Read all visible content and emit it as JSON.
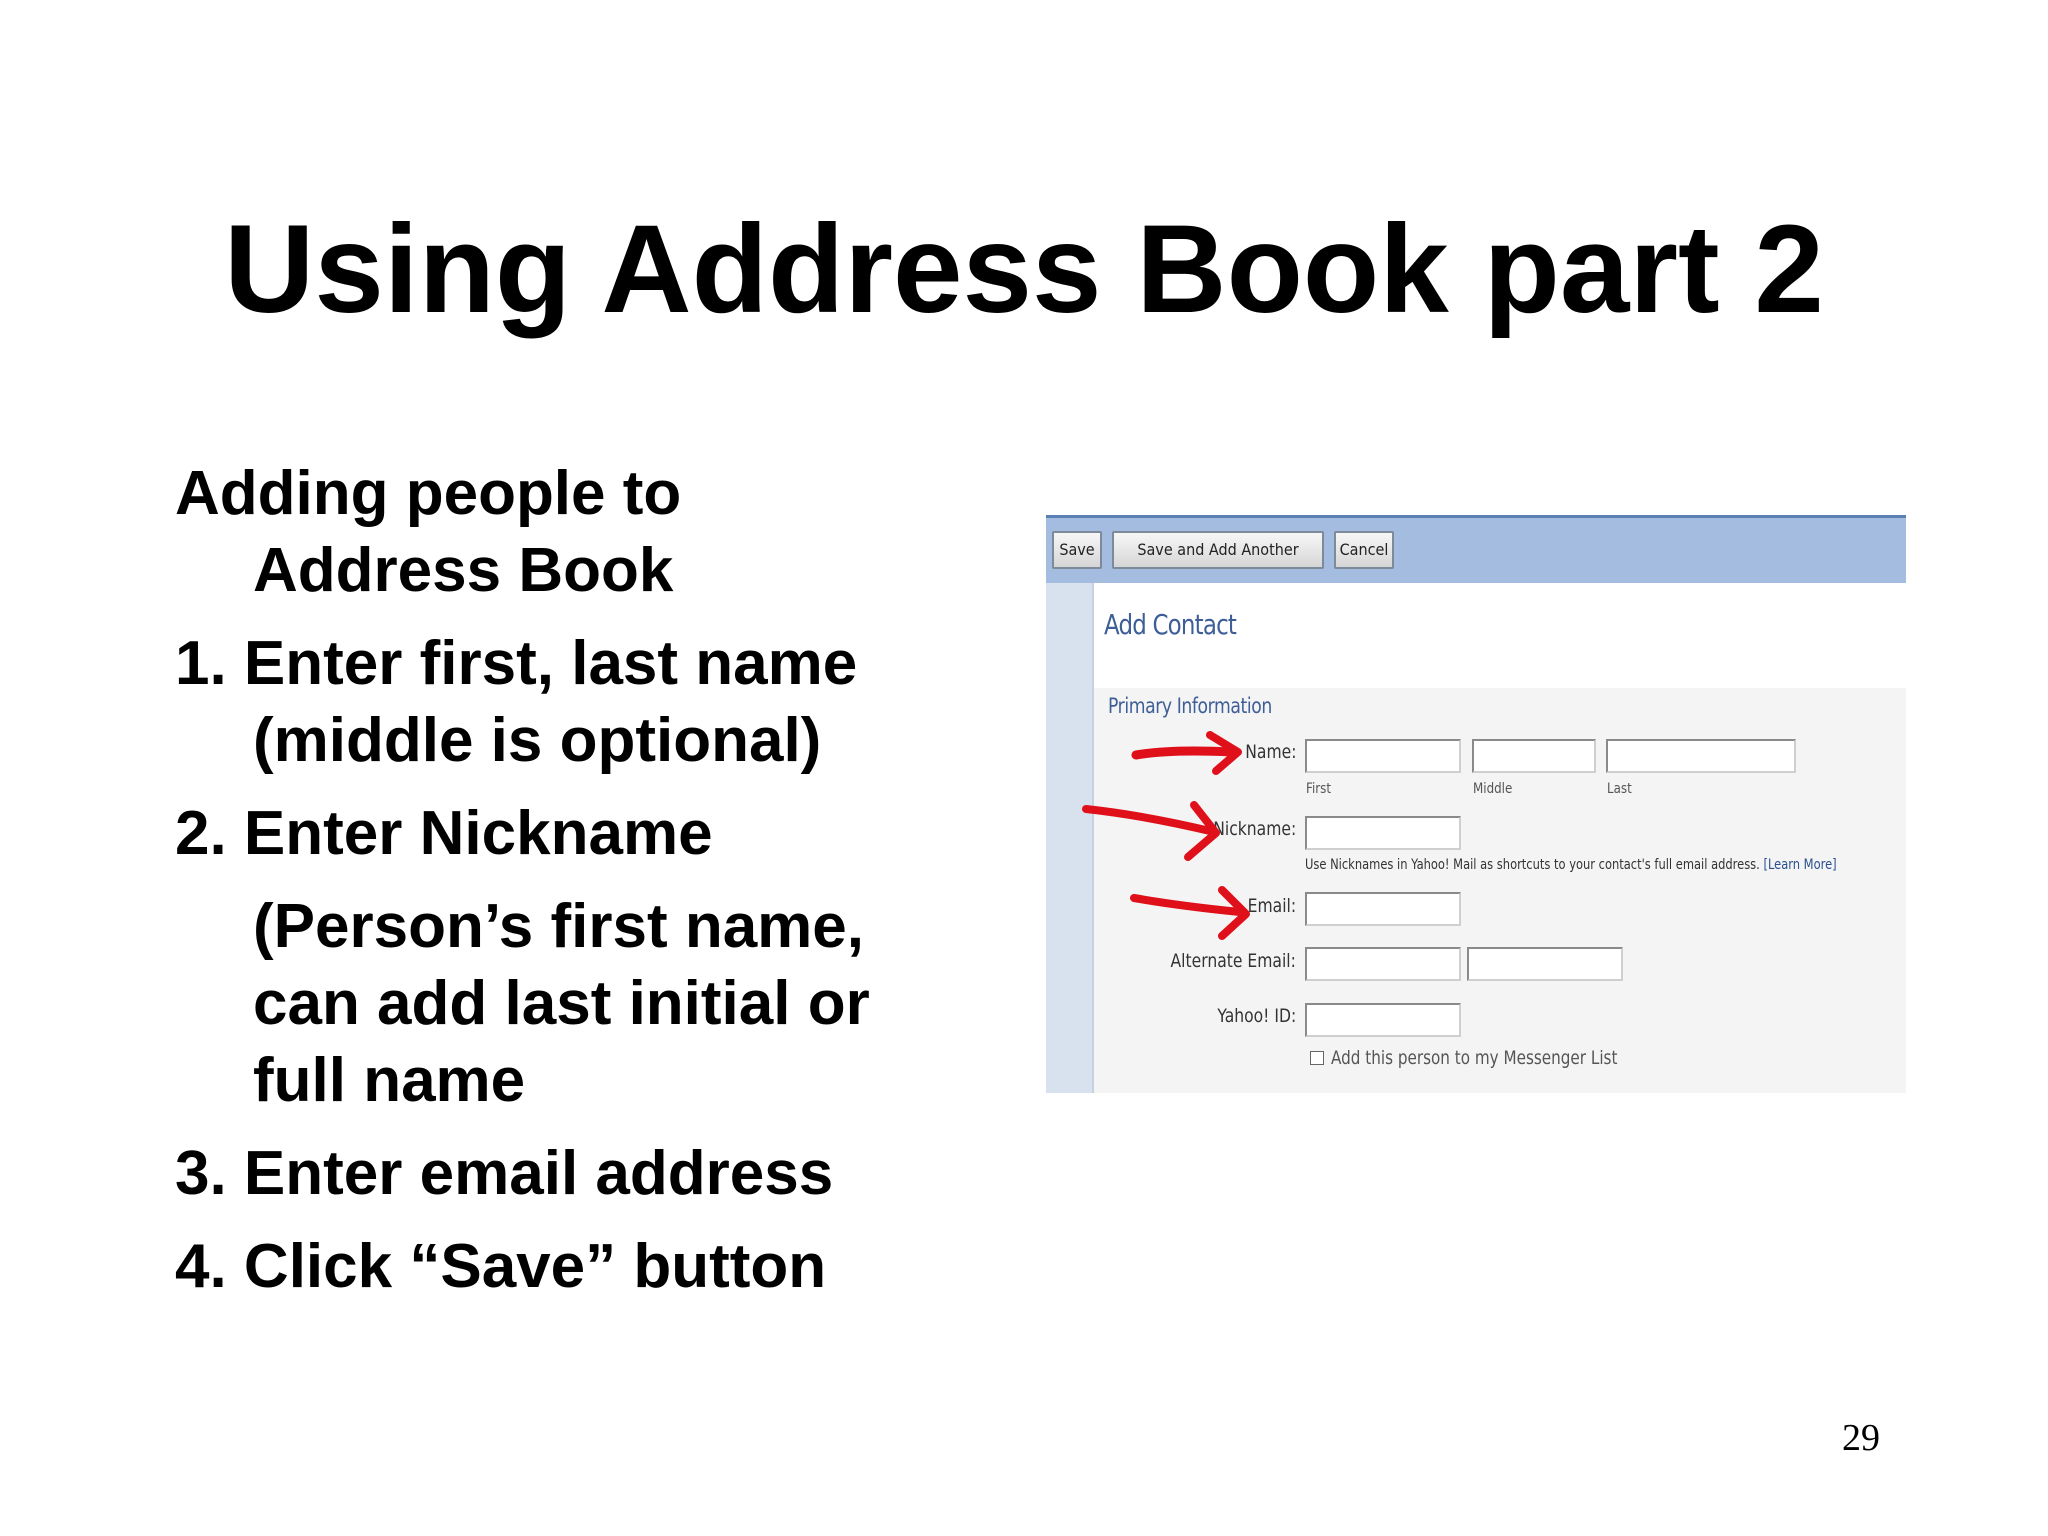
{
  "slide": {
    "title": "Using Address Book part 2",
    "intro_line1": "Adding people to",
    "intro_line2": "Address Book",
    "steps": [
      {
        "line1": "1. Enter first, last name",
        "line2": "(middle is optional)"
      },
      {
        "line1": "2. Enter Nickname"
      },
      {
        "note1": "(Person’s first name,",
        "note2": "can add last initial or",
        "note3": "full name"
      },
      {
        "line1": "3. Enter email address"
      },
      {
        "line1": "4. Click “Save” button"
      }
    ],
    "page_number": "29"
  },
  "screenshot": {
    "toolbar": {
      "save": "Save",
      "save_add_another": "Save and Add Another",
      "cancel": "Cancel"
    },
    "heading": "Add Contact",
    "section_title": "Primary Information",
    "fields": {
      "name_label": "Name:",
      "first_sub": "First",
      "middle_sub": "Middle",
      "last_sub": "Last",
      "nickname_label": "Nickname:",
      "nickname_help": "Use Nicknames in Yahoo! Mail as shortcuts to your contact's full email address.",
      "learn_more": "[Learn More]",
      "email_label": "Email:",
      "alt_email_label": "Alternate Email:",
      "yahoo_id_label": "Yahoo! ID:",
      "messenger_checkbox_label": "Add this person to my Messenger List",
      "messenger_checked": false
    },
    "annotation_color": "#e0101a",
    "toolbar_color": "#a3bcdf",
    "heading_color": "#3d5e96"
  }
}
